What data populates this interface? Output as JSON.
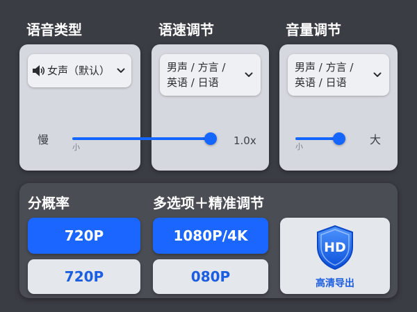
{
  "voice_type": {
    "title": "语音类型",
    "dropdown_value": "女声（默认）",
    "icon": "speaker-icon",
    "slider": {
      "min_label": "慢",
      "max_label": "1.0x",
      "tick_label": "小",
      "level": 1.0
    }
  },
  "speed": {
    "title": "语速调节",
    "dropdown_line1": "男声 / 方言 /",
    "dropdown_line2": "英语 / 日语"
  },
  "volume": {
    "title": "音量调节",
    "dropdown_line1": "男声 / 方言 /",
    "dropdown_line2": "英语 / 日语",
    "slider": {
      "tick_label": "小",
      "max_label": "大",
      "level": 1.0
    }
  },
  "resolution": {
    "title": "分概率",
    "option_selected": "720P",
    "option_other": "720P"
  },
  "multi": {
    "title": "多选项＋精准调节",
    "option_selected": "1080P/4K",
    "option_other": "080P"
  },
  "hd_export": {
    "badge": "HD",
    "label": "高清导出",
    "icon": "hd-shield-icon"
  },
  "colors": {
    "accent": "#1a66ff",
    "background": "#3a3d44",
    "panel": "#d5d8de"
  }
}
